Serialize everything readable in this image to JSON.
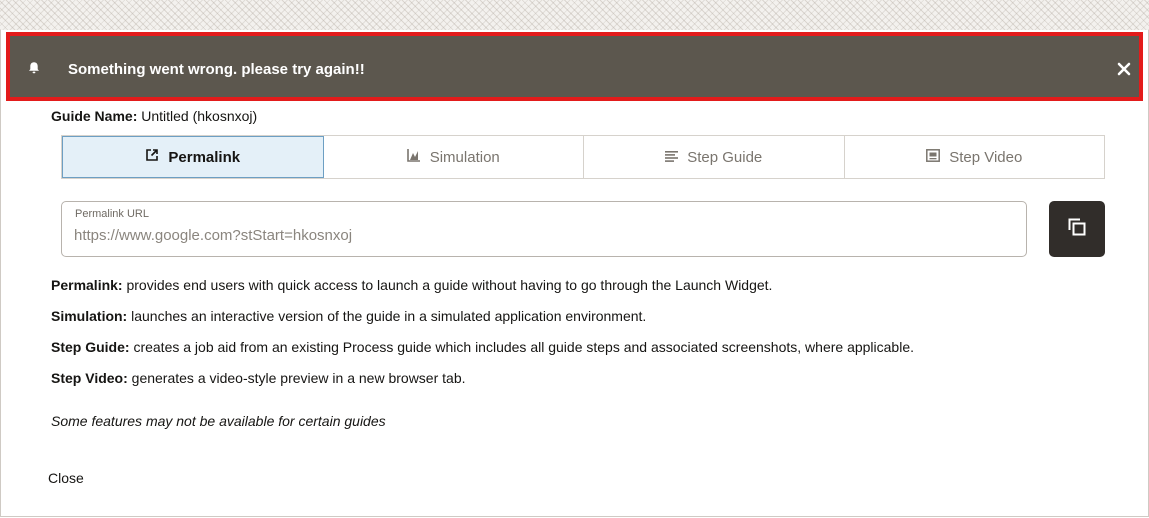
{
  "banner": {
    "message": "Something went wrong. please try again!!",
    "icon": "bell-icon",
    "close_icon": "close-icon",
    "bg_color": "#5c574e",
    "border_color": "#e31b1b"
  },
  "guide": {
    "name_label": "Guide Name:",
    "name_value": "Untitled (hkosnxoj)"
  },
  "tabs": [
    {
      "label": "Permalink",
      "icon": "external-link-icon",
      "active": true
    },
    {
      "label": "Simulation",
      "icon": "chart-icon",
      "active": false
    },
    {
      "label": "Step Guide",
      "icon": "list-icon",
      "active": false
    },
    {
      "label": "Step Video",
      "icon": "video-icon",
      "active": false
    }
  ],
  "permalink": {
    "label": "Permalink URL",
    "value": "https://www.google.com?stStart=hkosnxoj",
    "copy_icon": "copy-icon"
  },
  "descriptions": [
    {
      "term": "Permalink:",
      "text": " provides end users with quick access to launch a guide without having to go through the Launch Widget."
    },
    {
      "term": "Simulation:",
      "text": " launches an interactive version of the guide in a simulated application environment."
    },
    {
      "term": "Step Guide:",
      "text": " creates a job aid from an existing Process guide which includes all guide steps and associated screenshots, where applicable."
    },
    {
      "term": "Step Video:",
      "text": " generates a video-style preview in a new browser tab."
    }
  ],
  "note": "Some features may not be available for certain guides",
  "close_label": "Close",
  "colors": {
    "active_tab_bg": "#e4f0f8",
    "active_tab_border": "#6d9fc3",
    "copy_button_bg": "#312d2a"
  }
}
